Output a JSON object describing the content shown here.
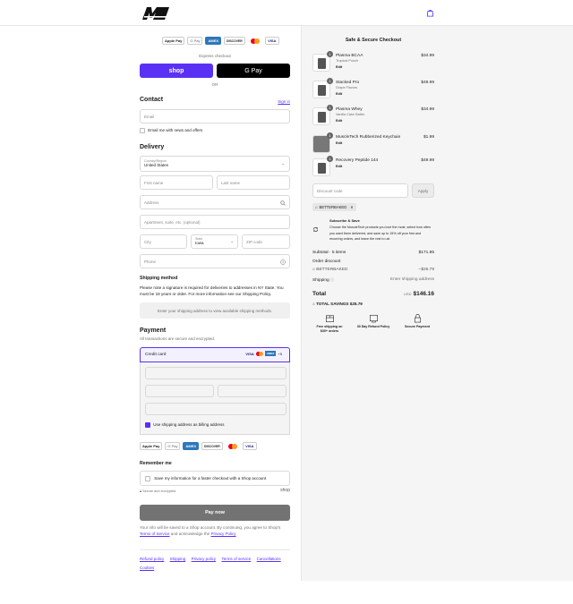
{
  "header": {
    "logo_alt": "MuscleTech",
    "cart_icon": "shopping-bag-icon"
  },
  "express": {
    "badges": [
      "Apple Pay",
      "G Pay",
      "AMEX",
      "DISCOVER",
      "MC",
      "VISA"
    ],
    "label": "Express checkout",
    "shop_pay": "shop",
    "google_pay": "G Pay",
    "or": "OR"
  },
  "contact": {
    "title": "Contact",
    "sign_in": "Sign in",
    "email_placeholder": "Email",
    "news_label": "Email me with news and offers"
  },
  "delivery": {
    "title": "Delivery",
    "country_label": "Country/Region",
    "country_value": "United States",
    "first_name": "First name",
    "last_name": "Last name",
    "address": "Address",
    "apartment": "Apartment, suite, etc. (optional)",
    "city": "City",
    "state_label": "State",
    "state_value": "Iowa",
    "zip": "ZIP code",
    "phone": "Phone"
  },
  "shipping_method": {
    "title": "Shipping method",
    "note": "Please note a signature is required for deliveries to addresses in NY State. You must be 18 years or older. For more information see our Shipping Policy.",
    "placeholder": "Enter your shipping address to view available shipping methods."
  },
  "payment": {
    "title": "Payment",
    "subtitle": "All transactions are secure and encrypted.",
    "credit_card": "Credit card",
    "more_cards": "+5",
    "use_shipping": "Use shipping address as billing address",
    "badges": [
      "Apple Pay",
      "G Pay",
      "AMEX",
      "DISCOVER",
      "MC",
      "VISA"
    ]
  },
  "remember": {
    "title": "Remember me",
    "save_label": "Save my information for a faster checkout with a Shop account",
    "secure": "Secure and encrypted",
    "shop": "shop"
  },
  "pay_now": "Pay now",
  "legal": {
    "text": "Your info will be saved to a Shop account. By continuing, you agree to Shop's",
    "terms": "Terms of Service",
    "and_ack": "and acknowledge the",
    "privacy": "Privacy Policy",
    "period": "."
  },
  "footer_links": [
    "Refund policy",
    "Shipping",
    "Privacy policy",
    "Terms of service",
    "Cancellations",
    "Cookies"
  ],
  "summary": {
    "title": "Safe & Secure Checkout",
    "items": [
      {
        "qty": "1",
        "name": "Plasma BCAA",
        "variant": "Tropical Punch",
        "edit": "Edit",
        "price": "$34.99"
      },
      {
        "qty": "1",
        "name": "Stacked Pro",
        "variant": "Grape Flavors",
        "edit": "Edit",
        "price": "$49.99"
      },
      {
        "qty": "1",
        "name": "Plasma Whey",
        "variant": "Vanilla Cake Batter",
        "edit": "Edit",
        "price": "$34.99"
      },
      {
        "qty": "1",
        "name": "MuscleTech Rubberized Keychain",
        "variant": "",
        "edit": "Edit",
        "price": "$1.99"
      },
      {
        "qty": "1",
        "name": "Recovery Peptide 144",
        "variant": "",
        "edit": "Edit",
        "price": "$49.99"
      }
    ],
    "discount_placeholder": "Discount code",
    "apply": "Apply",
    "code_tag": "BETTERBAKED",
    "subscribe_title": "Subscribe & Save",
    "subscribe_text": "Choose the MuscleTech products you love the most, select how often you want them delivered, and save up to 15% off your first and recurring orders, and leave the rest to us!",
    "subtotal_label": "Subtotal · 5 items",
    "subtotal_value": "$171.95",
    "order_discount": "Order discount",
    "discount_code": "BETTERBAKED",
    "discount_value": "−$25.79",
    "shipping_label": "Shipping",
    "shipping_value": "Enter shipping address",
    "total_label": "Total",
    "currency": "USD",
    "total_value": "$146.16",
    "savings_label": "TOTAL SAVINGS",
    "savings_value": "$25.79",
    "perks": [
      {
        "icon": "shipping-box-icon",
        "text": "Free shipping on $30+ orders"
      },
      {
        "icon": "refund-icon",
        "text": "30 Day Refund Policy"
      },
      {
        "icon": "lock-icon",
        "text": "Secure Payment"
      }
    ]
  }
}
